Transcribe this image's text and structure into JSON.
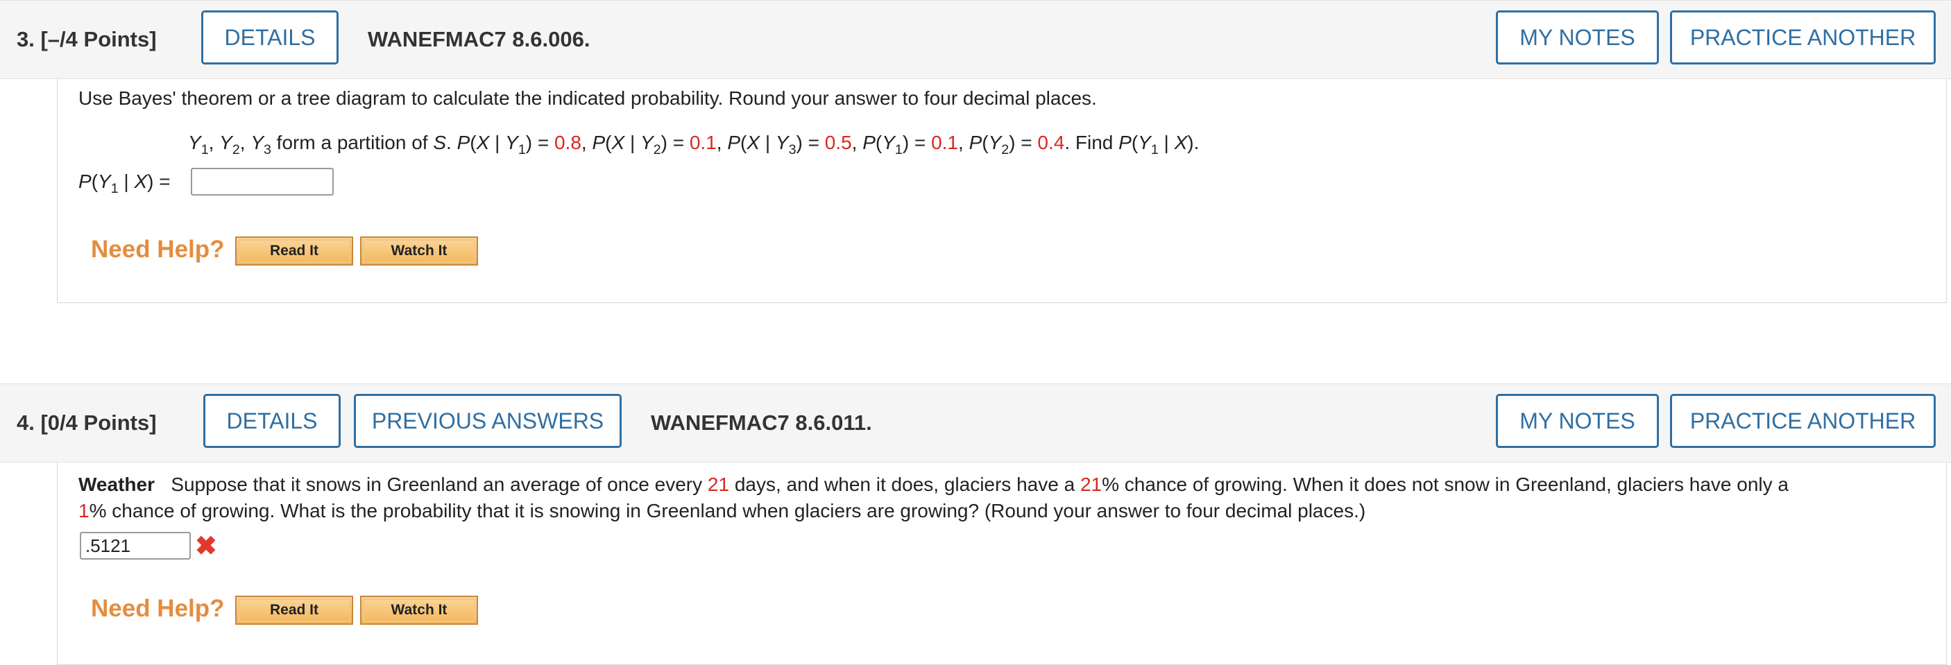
{
  "q3": {
    "number": "3.",
    "points": "[–/4 Points]",
    "details_label": "DETAILS",
    "code": "WANEFMAC7 8.6.006.",
    "my_notes_label": "MY NOTES",
    "practice_label": "PRACTICE ANOTHER",
    "instruction": "Use Bayes' theorem or a tree diagram to calculate the indicated probability. Round your answer to four decimal places.",
    "given": {
      "px_y1": "0.8",
      "px_y2": "0.1",
      "px_y3": "0.5",
      "py1": "0.1",
      "py2": "0.4"
    },
    "answer_label": "P(Y1 | X) =",
    "answer_value": "",
    "need_help": "Need Help?",
    "read_it": "Read It",
    "watch_it": "Watch It"
  },
  "q4": {
    "number": "4.",
    "points": "[0/4 Points]",
    "details_label": "DETAILS",
    "previous_label": "PREVIOUS ANSWERS",
    "code": "WANEFMAC7 8.6.011.",
    "my_notes_label": "MY NOTES",
    "practice_label": "PRACTICE ANOTHER",
    "topic": "Weather",
    "text_a": "Suppose that it snows in Greenland an average of once every ",
    "days": "21",
    "text_b": " days, and when it does, glaciers have a ",
    "chance_snow": "21",
    "text_c": "% chance of growing. When it does not snow in Greenland, glaciers have only a",
    "chance_nosnow": "1",
    "text_d": "% chance of growing. What is the probability that it is snowing in Greenland when glaciers are growing? (Round your answer to four decimal places.)",
    "answer_value": ".5121",
    "need_help": "Need Help?",
    "read_it": "Read It",
    "watch_it": "Watch It"
  },
  "colors": {
    "accent": "#2f6fa3",
    "given_value": "#d9281f",
    "wrong_mark": "#e03a2f",
    "help_text": "#e48d3e"
  }
}
